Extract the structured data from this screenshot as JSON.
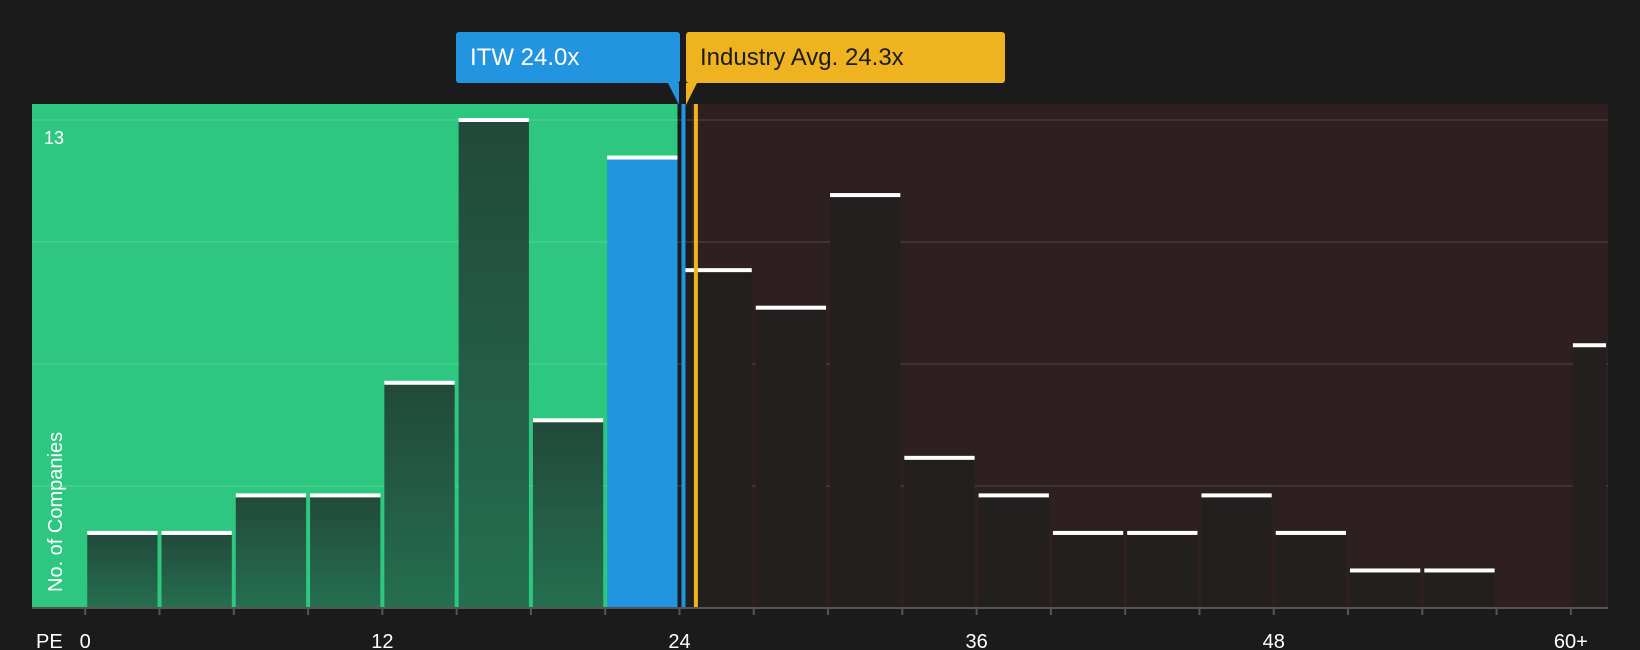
{
  "chart_data": {
    "type": "bar",
    "xlabel": "PE",
    "ylabel": "No. of Companies",
    "x_tick_labels": [
      "0",
      "12",
      "24",
      "36",
      "48",
      "60+"
    ],
    "x_tick_values": [
      0,
      12,
      24,
      36,
      48,
      60
    ],
    "y_max_label": "13",
    "ylim": [
      0,
      13
    ],
    "bin_width": 3,
    "bins": [
      {
        "start": 0,
        "end": 3,
        "count": 2
      },
      {
        "start": 3,
        "end": 6,
        "count": 2
      },
      {
        "start": 6,
        "end": 9,
        "count": 3
      },
      {
        "start": 9,
        "end": 12,
        "count": 3
      },
      {
        "start": 12,
        "end": 15,
        "count": 6
      },
      {
        "start": 15,
        "end": 18,
        "count": 13
      },
      {
        "start": 18,
        "end": 21,
        "count": 5
      },
      {
        "start": 21,
        "end": 24,
        "count": 12
      },
      {
        "start": 24,
        "end": 27,
        "count": 9
      },
      {
        "start": 27,
        "end": 30,
        "count": 8
      },
      {
        "start": 30,
        "end": 33,
        "count": 11
      },
      {
        "start": 33,
        "end": 36,
        "count": 4
      },
      {
        "start": 36,
        "end": 39,
        "count": 3
      },
      {
        "start": 39,
        "end": 42,
        "count": 2
      },
      {
        "start": 42,
        "end": 45,
        "count": 2
      },
      {
        "start": 45,
        "end": 48,
        "count": 3
      },
      {
        "start": 48,
        "end": 51,
        "count": 2
      },
      {
        "start": 51,
        "end": 54,
        "count": 1
      },
      {
        "start": 54,
        "end": 57,
        "count": 1
      },
      {
        "start": 57,
        "end": 60,
        "count": 0
      },
      {
        "start": 60,
        "end": 61.5,
        "count": 7
      }
    ],
    "highlight_bin_start": 21,
    "company": {
      "ticker": "ITW",
      "value": 24.0,
      "label": "ITW 24.0x"
    },
    "industry": {
      "value": 24.3,
      "label": "Industry Avg. 24.3x"
    },
    "x_domain": [
      -2.15,
      61.5
    ],
    "grid": true,
    "colors": {
      "background": "#1b1b1b",
      "undervalued_zone": "#2ec77f",
      "overvalued_zone": "#2e1f20",
      "bar_on_green": "#24473a",
      "bar_on_red": "#231f1f",
      "company": "#2394df",
      "industry": "#eeb31f",
      "bar_top": "#ffffff"
    }
  }
}
